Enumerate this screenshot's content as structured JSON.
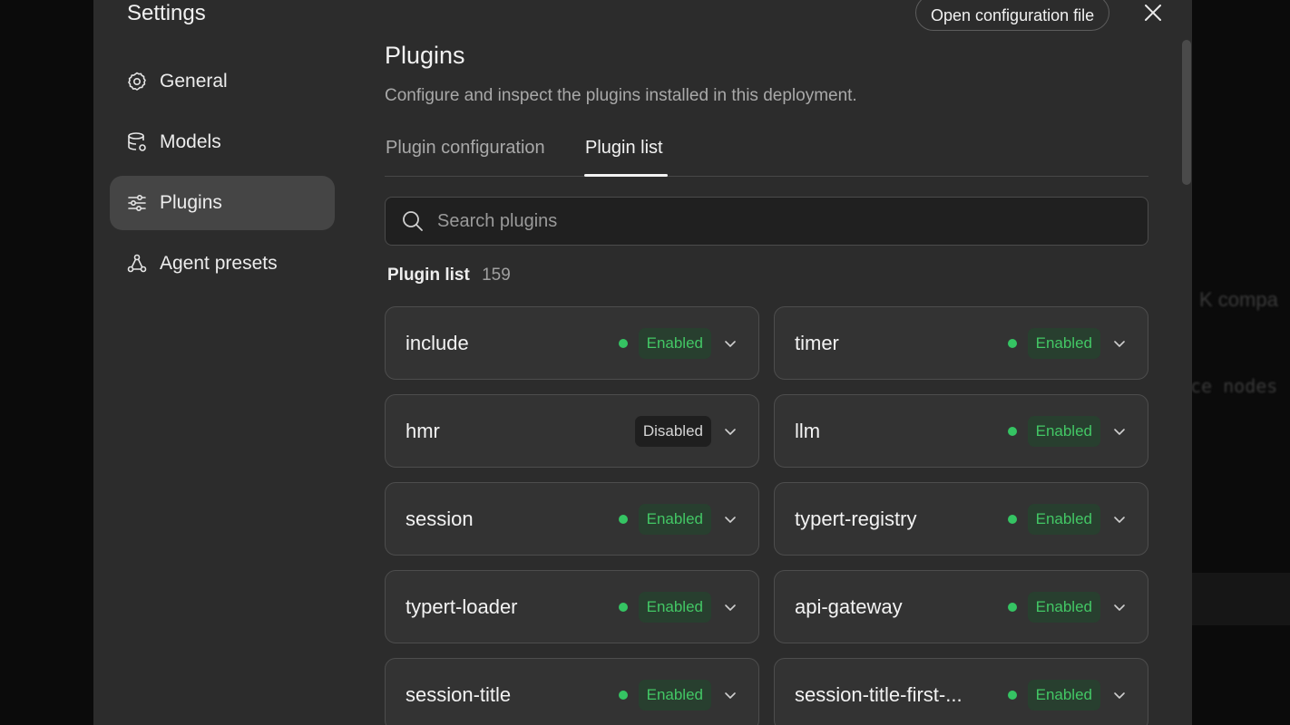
{
  "background": {
    "text_a": "K compa",
    "text_b": "ce nodes"
  },
  "modal": {
    "title": "Settings",
    "open_config_label": "Open configuration file"
  },
  "sidebar": {
    "items": [
      {
        "label": "General",
        "icon": "gear-icon",
        "active": false
      },
      {
        "label": "Models",
        "icon": "database-icon",
        "active": false
      },
      {
        "label": "Plugins",
        "icon": "sliders-icon",
        "active": true
      },
      {
        "label": "Agent presets",
        "icon": "agent-nodes-icon",
        "active": false
      }
    ]
  },
  "main": {
    "title": "Plugins",
    "subtitle": "Configure and inspect the plugins installed in this deployment.",
    "tabs": [
      {
        "label": "Plugin configuration",
        "active": false
      },
      {
        "label": "Plugin list",
        "active": true
      }
    ],
    "search": {
      "placeholder": "Search plugins",
      "value": ""
    },
    "list_label": "Plugin list",
    "list_count": "159",
    "plugins": [
      {
        "name": "include",
        "status": "Enabled"
      },
      {
        "name": "timer",
        "status": "Enabled"
      },
      {
        "name": "hmr",
        "status": "Disabled"
      },
      {
        "name": "llm",
        "status": "Enabled"
      },
      {
        "name": "session",
        "status": "Enabled"
      },
      {
        "name": "typert-registry",
        "status": "Enabled"
      },
      {
        "name": "typert-loader",
        "status": "Enabled"
      },
      {
        "name": "api-gateway",
        "status": "Enabled"
      },
      {
        "name": "session-title",
        "status": "Enabled"
      },
      {
        "name": "session-title-first-...",
        "status": "Enabled"
      }
    ]
  },
  "colors": {
    "enabled": "#43c765",
    "accent_dot": "#35c463",
    "panel": "#2c2c2c"
  }
}
